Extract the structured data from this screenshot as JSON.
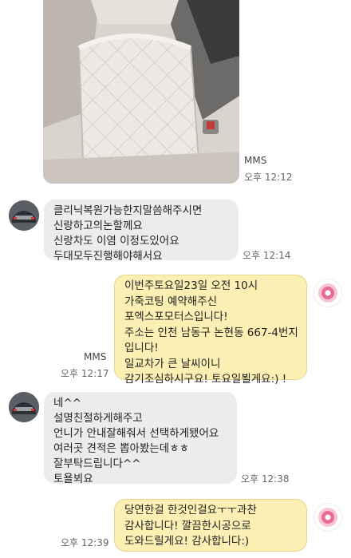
{
  "photo": {
    "icon": "car-seat-photo"
  },
  "messages": [
    {
      "id": "m1",
      "side": "left",
      "type_label": "MMS",
      "time": "오후 12:12"
    },
    {
      "id": "m2",
      "side": "left",
      "lines": [
        "클리닉복원가능한지말씀해주시면",
        "신랑하고의논할께요",
        "신랑차도 이염 이정도있어요",
        "두대모두진행해야해서요"
      ],
      "time": "오후 12:14"
    },
    {
      "id": "m3",
      "side": "right",
      "lines": [
        "이번주토요일23일 오전 10시",
        "가죽코팅 예약해주신",
        "포엑스포모터스입니다!",
        "주소는 인천 남동구 논현동 667-4번지",
        "입니다!",
        "일교차가 큰 날씨이니",
        "감기조심하시구요! 토요일뵐게요:) !"
      ],
      "type_label": "MMS",
      "time": "오후 12:17"
    },
    {
      "id": "m4",
      "side": "left",
      "lines": [
        "네^^",
        "설명친절하게해주고",
        "언니가 안내잘해줘서 선택하게됐어요",
        "여러곳 견적은 뽑아봤는데ㅎㅎ",
        "잘부탁드립니다^^",
        "토욜뵈요"
      ],
      "time": "오후 12:38"
    },
    {
      "id": "m5",
      "side": "right",
      "lines": [
        "당연한걸 한것인걸요ㅜㅜ과찬",
        "감사합니다! 깔끔한시공으로",
        "도와드릴게요! 감사합니다:)"
      ],
      "time": "오후 12:39"
    }
  ],
  "colors": {
    "incoming_bubble": "#ececec",
    "outgoing_bubble": "#fbefb3",
    "background": "#ffffff"
  }
}
